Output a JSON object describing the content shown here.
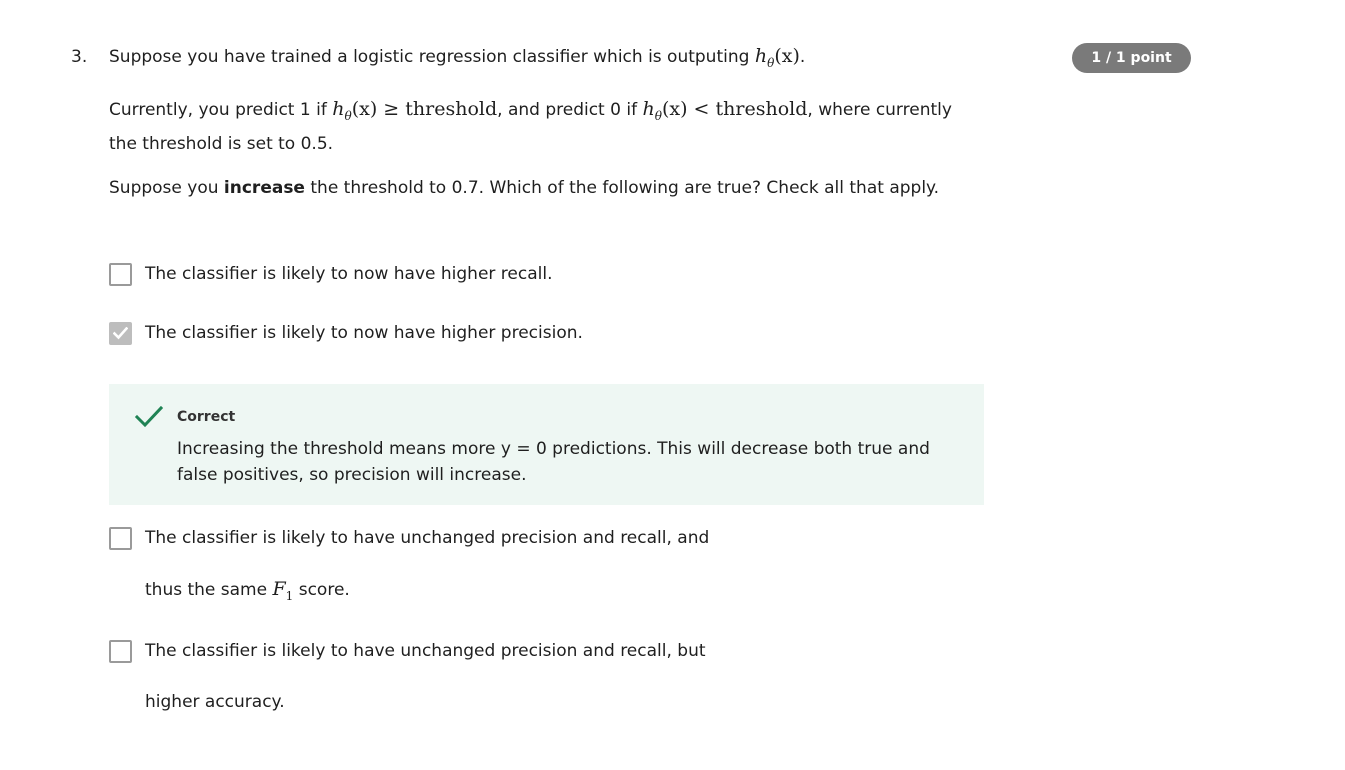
{
  "question": {
    "number": "3.",
    "points": "1 / 1 point",
    "line1_text": "Suppose you have trained a logistic regression classifier which is outputing",
    "math_h": "h",
    "math_theta": "θ",
    "math_x": "(x)",
    "period": ".",
    "line2_a": "Currently, you predict 1 if",
    "ge": "≥",
    "threshold_word": "threshold",
    "line2_b": ", and predict 0 if",
    "lt": "<",
    "line2_c": ", where currently the threshold is set to 0.5.",
    "line3_a": "Suppose you",
    "line3_bold": "increase",
    "line3_b": "the threshold to 0.7. Which of the following are true? Check all that apply."
  },
  "options": [
    {
      "text": "The classifier is likely to now have higher recall.",
      "checked": false
    },
    {
      "text": "The classifier is likely to now have higher precision.",
      "checked": true
    },
    {
      "text": "The classifier is likely to have unchanged precision and recall, and",
      "text2_a": "thus the same",
      "f": "F",
      "f_sub": "1",
      "text2_b": "score.",
      "checked": false
    },
    {
      "text": "The classifier is likely to have unchanged precision and recall, but",
      "text2": "higher accuracy.",
      "checked": false
    }
  ],
  "feedback": {
    "label": "Correct",
    "text": "Increasing the threshold means more y = 0 predictions. This will decrease both true and false positives, so precision will increase.",
    "color": "#1f8354",
    "background": "#eef7f3"
  },
  "icons": {
    "checkbox_check": "checkmark-icon",
    "feedback_check": "correct-check-icon"
  }
}
